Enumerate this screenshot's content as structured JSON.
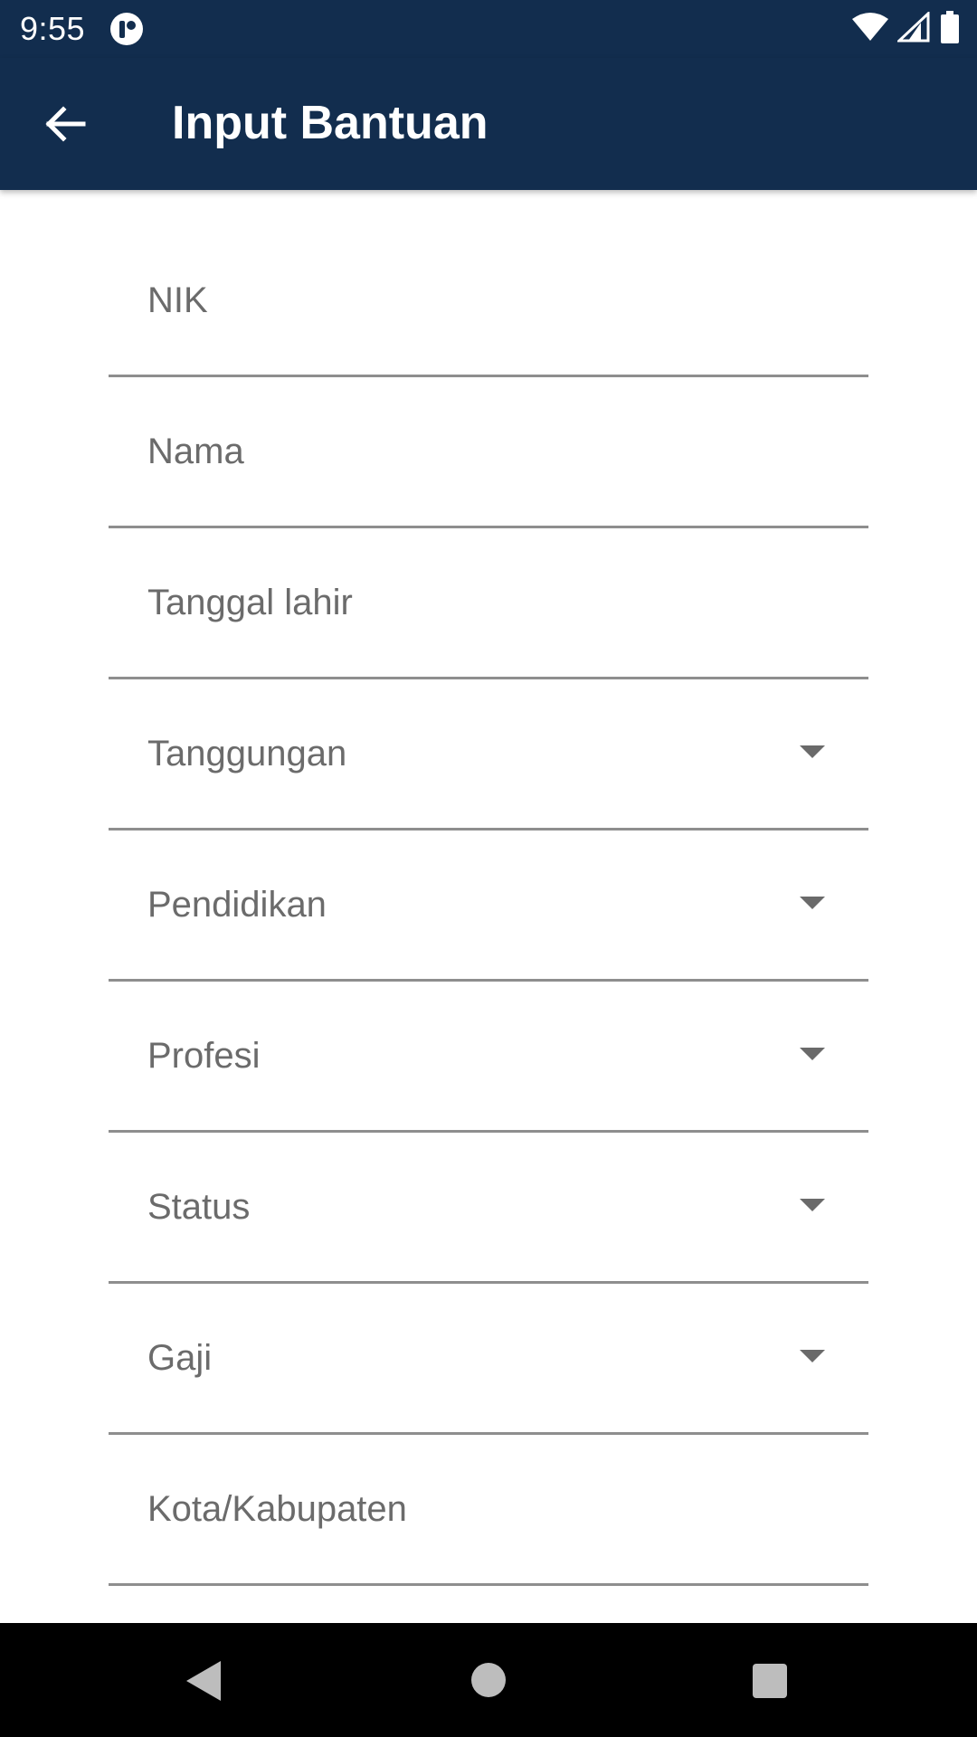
{
  "status_bar": {
    "time": "9:55",
    "app_icon": "notification-app-icon",
    "icons": [
      "wifi-icon",
      "signal-icon",
      "battery-icon"
    ]
  },
  "app_bar": {
    "title": "Input Bantuan",
    "back_icon": "arrow-left-icon"
  },
  "form": {
    "fields": [
      {
        "label": "NIK",
        "type": "text"
      },
      {
        "label": "Nama",
        "type": "text"
      },
      {
        "label": "Tanggal lahir",
        "type": "text"
      },
      {
        "label": "Tanggungan",
        "type": "dropdown"
      },
      {
        "label": "Pendidikan",
        "type": "dropdown"
      },
      {
        "label": "Profesi",
        "type": "dropdown"
      },
      {
        "label": "Status",
        "type": "dropdown"
      },
      {
        "label": "Gaji",
        "type": "dropdown"
      },
      {
        "label": "Kota/Kabupaten",
        "type": "text"
      }
    ]
  },
  "nav_bar": {
    "buttons": [
      "back-triangle-icon",
      "home-circle-icon",
      "recents-square-icon"
    ]
  },
  "colors": {
    "primary": "#122d4e",
    "field_text": "#6b6b6b",
    "underline": "#8e8e8e",
    "nav_bar": "#000000"
  }
}
